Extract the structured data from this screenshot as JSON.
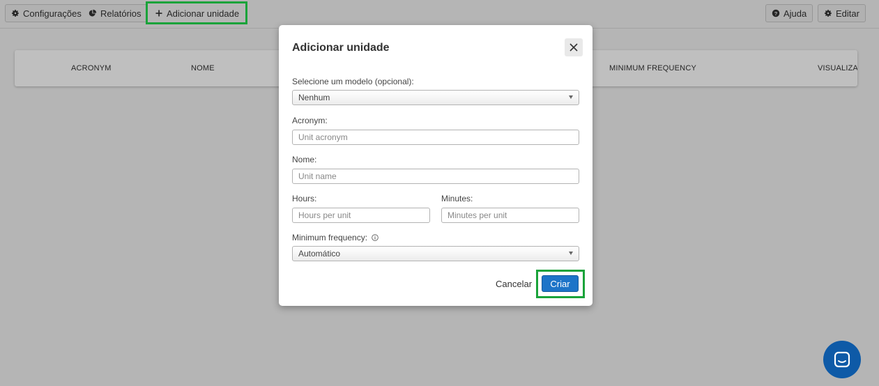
{
  "toolbar": {
    "configuracoes_label": "Configurações",
    "relatorios_label": "Relatórios",
    "add_unit_label": "Adicionar unidade",
    "help_label": "Ajuda",
    "edit_label": "Editar"
  },
  "table": {
    "columns": [
      "ACRONYM",
      "NOME",
      "MINIMUM FREQUENCY",
      "VISUALIZAR"
    ]
  },
  "modal": {
    "title": "Adicionar unidade",
    "model_label": "Selecione um modelo (opcional):",
    "model_value": "Nenhum",
    "acronym_label": "Acronym:",
    "acronym_placeholder": "Unit acronym",
    "name_label": "Nome:",
    "name_placeholder": "Unit name",
    "hours_label": "Hours:",
    "hours_placeholder": "Hours per unit",
    "minutes_label": "Minutes:",
    "minutes_placeholder": "Minutes per unit",
    "min_freq_label": "Minimum frequency:",
    "min_freq_value": "Automático",
    "cancel_label": "Cancelar",
    "create_label": "Criar"
  },
  "colors": {
    "primary": "#1d74c8",
    "highlight": "#1aa33a",
    "chat": "#0e5aa7"
  }
}
